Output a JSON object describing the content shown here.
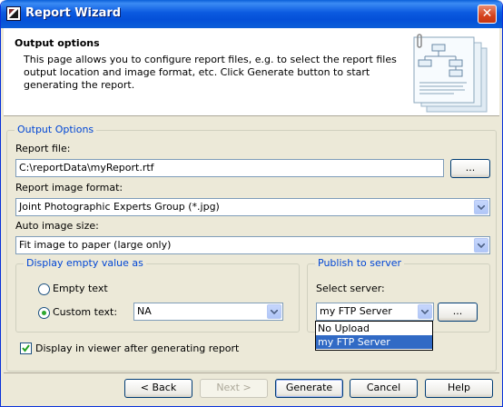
{
  "window": {
    "title": "Report Wizard",
    "close_glyph": "✕"
  },
  "header": {
    "title": "Output options",
    "description": "This page allows you to configure report files, e.g. to select the report files output location and image format, etc. Click Generate button to start generating the report.",
    "art_icon": "report-documents-icon"
  },
  "output_options": {
    "group_title": "Output Options",
    "report_file_label": "Report file:",
    "report_file_value": "C:\\reportData\\myReport.rtf",
    "browse_label": "...",
    "image_format_label": "Report image format:",
    "image_format_value": "Joint Photographic Experts Group (*.jpg)",
    "auto_size_label": "Auto image size:",
    "auto_size_value": "Fit image to paper (large only)"
  },
  "empty_value": {
    "group_title": "Display empty value as",
    "empty_text_label": "Empty text",
    "custom_text_label": "Custom text:",
    "custom_text_value": "NA",
    "selected": "custom"
  },
  "publish": {
    "group_title": "Publish to server",
    "select_label": "Select server:",
    "server_value": "my FTP Server",
    "browse_label": "...",
    "options": [
      "No Upload",
      "my FTP Server"
    ],
    "selected_index": 1
  },
  "viewer_checkbox": {
    "label": "Display in viewer after generating report",
    "checked": true
  },
  "buttons": {
    "back": "< Back",
    "next": "Next >",
    "generate": "Generate",
    "cancel": "Cancel",
    "help": "Help"
  },
  "colors": {
    "title_bar": "#0a5fd8",
    "group_title": "#0046d5",
    "selection": "#316ac5",
    "radio_dot": "#2fa82f"
  }
}
